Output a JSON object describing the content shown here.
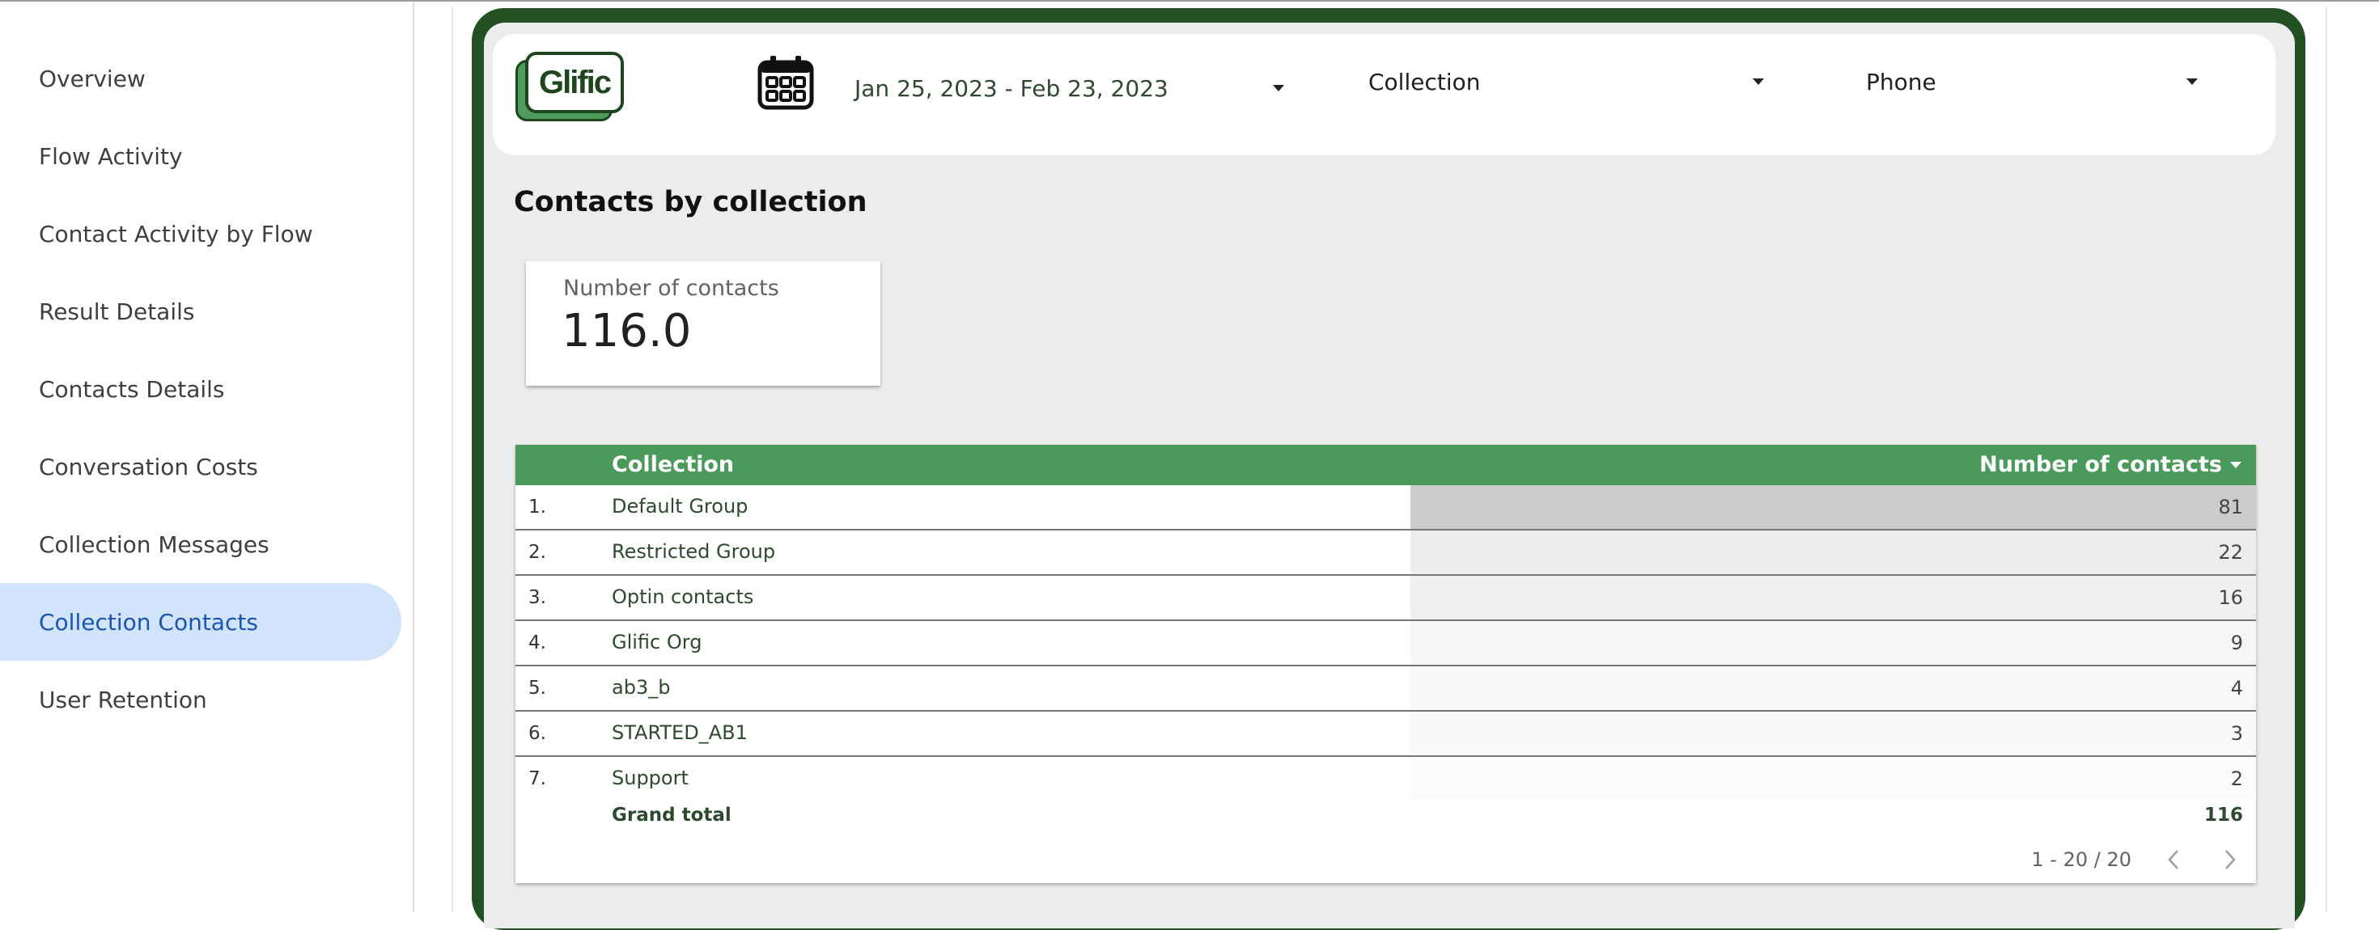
{
  "sidebar": {
    "items": [
      {
        "label": "Overview"
      },
      {
        "label": "Flow Activity"
      },
      {
        "label": "Contact Activity by Flow"
      },
      {
        "label": "Result Details"
      },
      {
        "label": "Contacts Details"
      },
      {
        "label": "Conversation Costs"
      },
      {
        "label": "Collection Messages"
      },
      {
        "label": "Collection Contacts",
        "active": true
      },
      {
        "label": "User Retention"
      }
    ]
  },
  "header": {
    "logo_text": "Glific",
    "date_range": "Jan 25, 2023 - Feb 23, 2023",
    "filter_collection": "Collection",
    "filter_phone": "Phone",
    "icons": [
      "calendar-icon",
      "dropdown-caret-icon"
    ]
  },
  "section": {
    "title": "Contacts by collection"
  },
  "scorecard": {
    "label": "Number of contacts",
    "value": "116.0"
  },
  "table": {
    "columns": [
      "Collection",
      "Number of contacts"
    ],
    "rows": [
      {
        "index": "1.",
        "name": "Default Group",
        "value": "81",
        "bar_color": "#cccccc"
      },
      {
        "index": "2.",
        "name": "Restricted Group",
        "value": "22",
        "bar_color": "#ededed"
      },
      {
        "index": "3.",
        "name": "Optin contacts",
        "value": "16",
        "bar_color": "#f0f0f0"
      },
      {
        "index": "4.",
        "name": "Glific Org",
        "value": "9",
        "bar_color": "#f6f6f6"
      },
      {
        "index": "5.",
        "name": "ab3_b",
        "value": "4",
        "bar_color": "#f9f9f9"
      },
      {
        "index": "6.",
        "name": "STARTED_AB1",
        "value": "3",
        "bar_color": "#fafafa"
      },
      {
        "index": "7.",
        "name": "Support",
        "value": "2",
        "bar_color": "#fbfbfb"
      }
    ],
    "grand_total_label": "Grand total",
    "grand_total_value": "116",
    "pagination": "1 - 20 / 20"
  },
  "colors": {
    "brand_dark_green": "#245124",
    "header_green": "#4a9a5c",
    "active_nav_bg": "#d2e3fc",
    "active_nav_text": "#1a55b0"
  }
}
